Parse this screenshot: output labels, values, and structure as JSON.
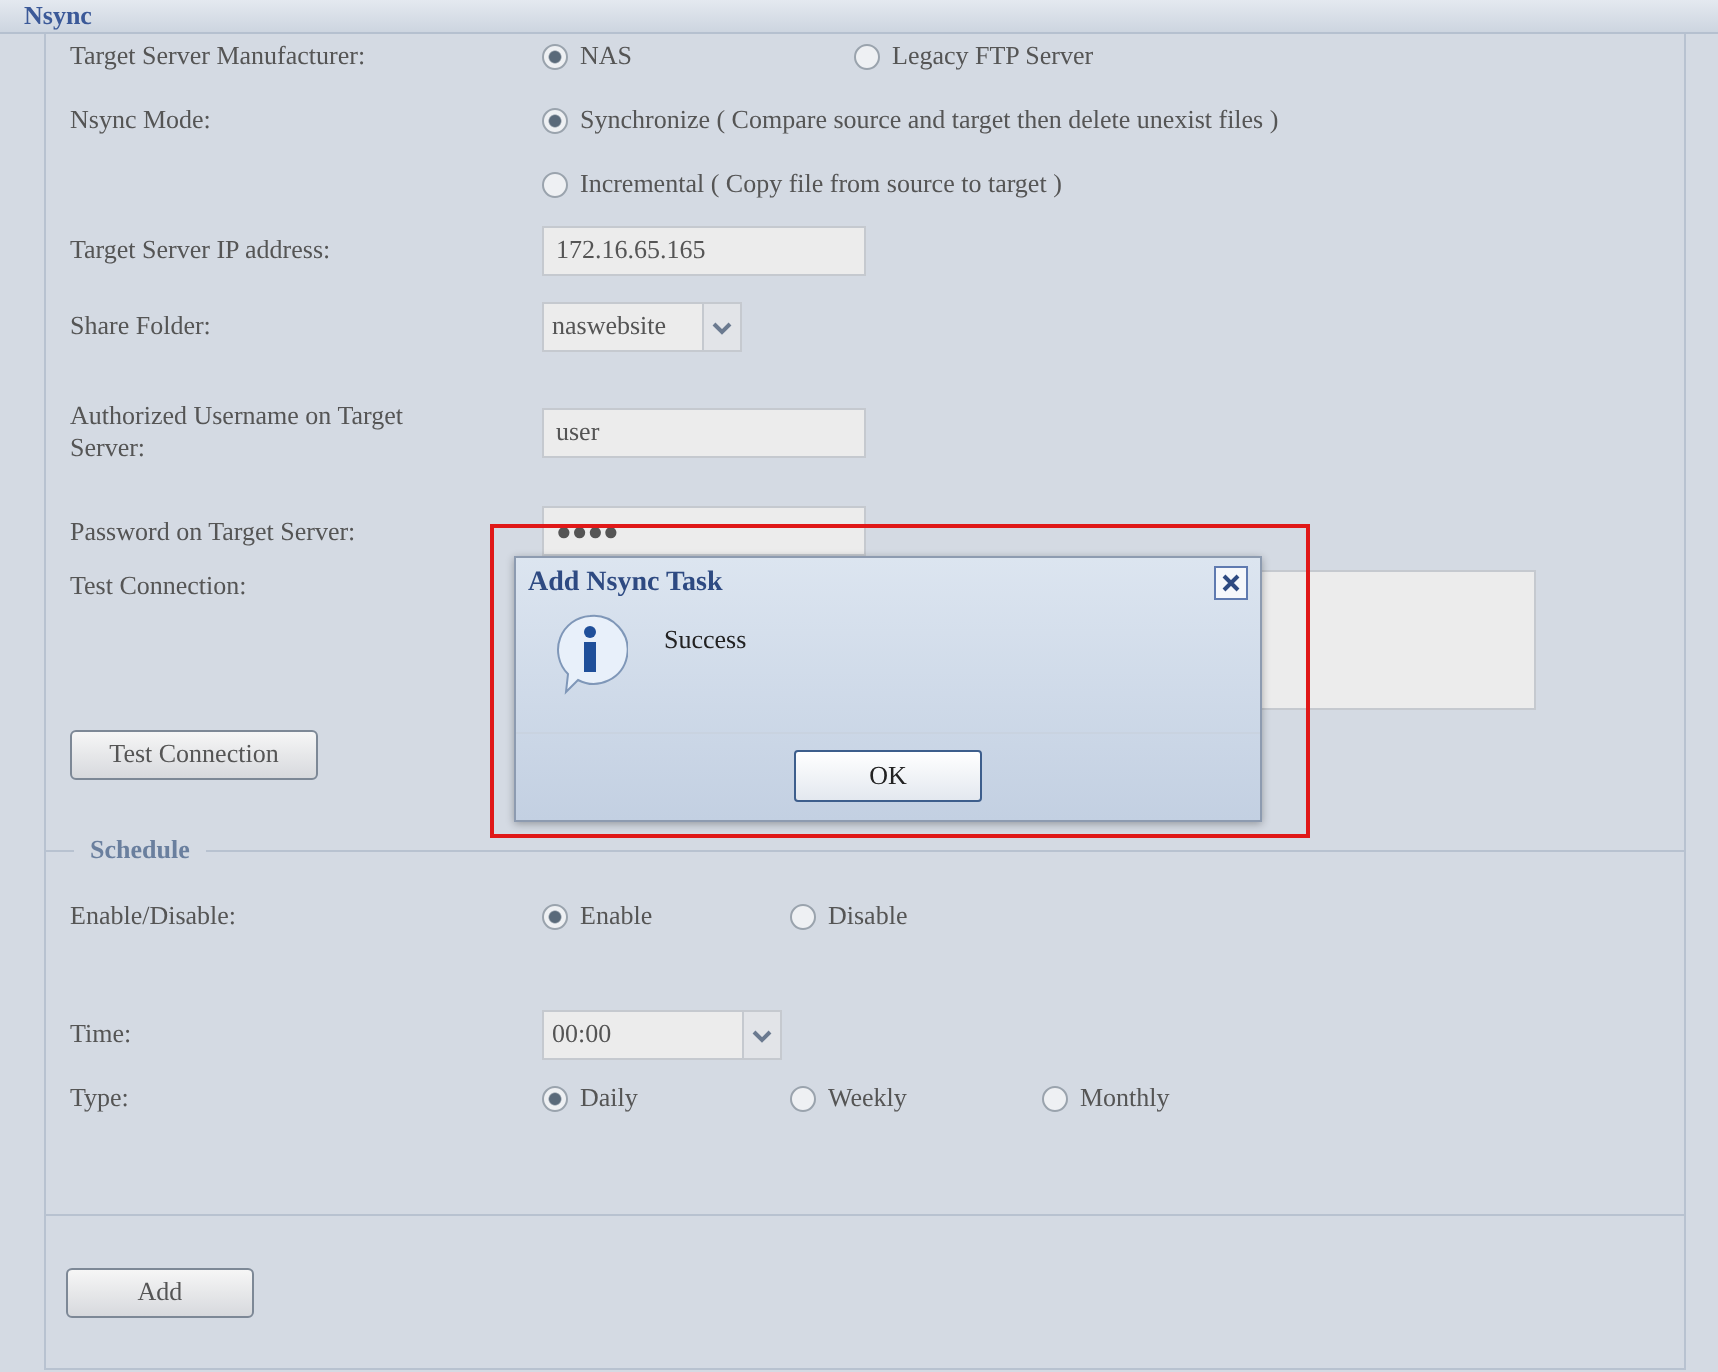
{
  "header": {
    "title": "Nsync"
  },
  "manufacturer": {
    "label": "Target Server Manufacturer:",
    "options": [
      {
        "label": "NAS",
        "selected": true
      },
      {
        "label": "Legacy FTP Server",
        "selected": false
      }
    ]
  },
  "mode": {
    "label": "Nsync Mode:",
    "options": [
      {
        "label": "Synchronize ( Compare source and target then delete unexist files )",
        "selected": true
      },
      {
        "label": "Incremental ( Copy file from source to target )",
        "selected": false
      }
    ]
  },
  "ip": {
    "label": "Target Server IP address:",
    "value": "172.16.65.165"
  },
  "share": {
    "label": "Share Folder:",
    "value": "naswebsite"
  },
  "username": {
    "label": "Authorized Username on Target Server:",
    "value": "user"
  },
  "password": {
    "label": "Password on Target Server:",
    "value": "●●●●"
  },
  "test": {
    "label": "Test Connection:",
    "button": "Test Connection"
  },
  "schedule": {
    "legend": "Schedule",
    "enable": {
      "label": "Enable/Disable:",
      "options": [
        {
          "label": "Enable",
          "selected": true
        },
        {
          "label": "Disable",
          "selected": false
        }
      ]
    },
    "time": {
      "label": "Time:",
      "value": "00:00"
    },
    "type": {
      "label": "Type:",
      "options": [
        {
          "label": "Daily",
          "selected": true
        },
        {
          "label": "Weekly",
          "selected": false
        },
        {
          "label": "Monthly",
          "selected": false
        }
      ]
    }
  },
  "add_button": "Add",
  "dialog": {
    "title": "Add Nsync Task",
    "message": "Success",
    "button": "OK"
  }
}
